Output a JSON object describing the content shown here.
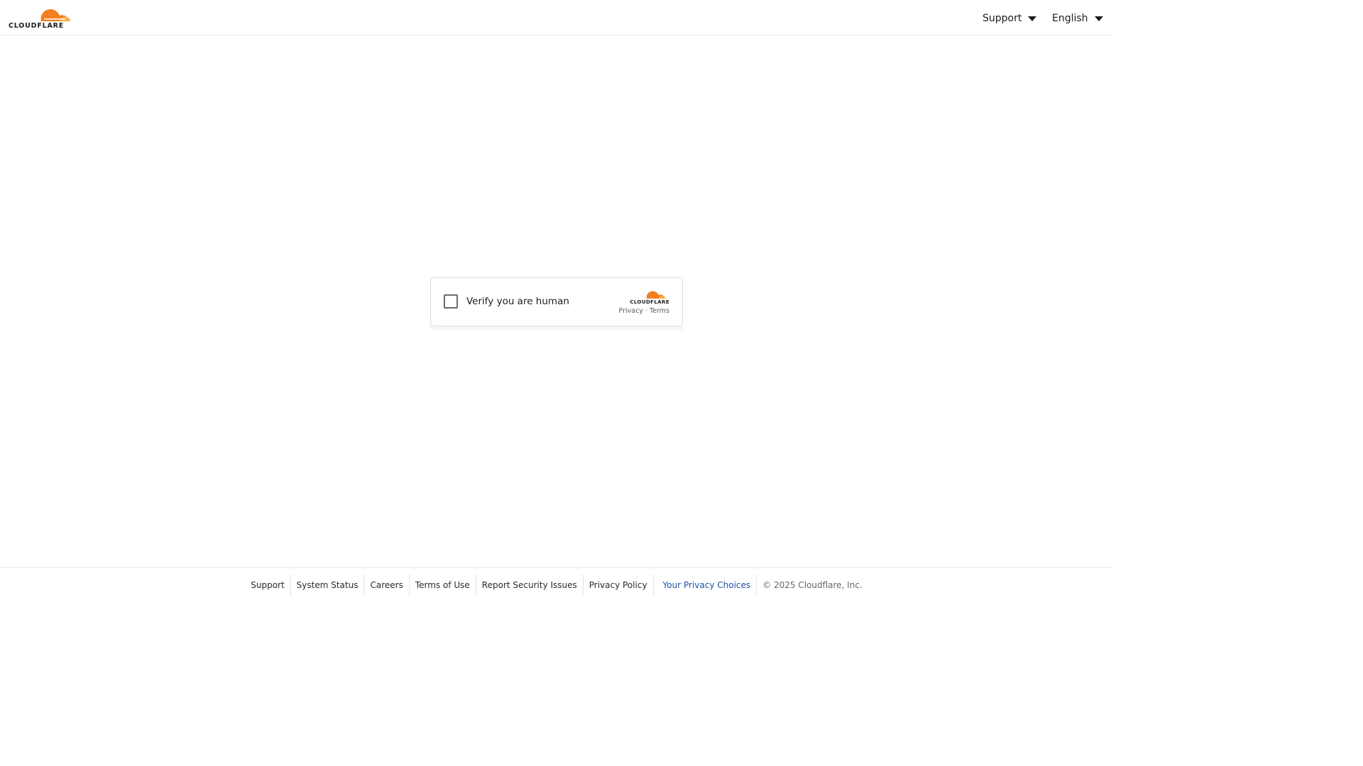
{
  "header": {
    "logo_text": "CLOUDFLARE",
    "nav": {
      "support_label": "Support",
      "language_label": "English"
    }
  },
  "widget": {
    "checkbox_label": "Verify you are human",
    "brand_text": "CLOUDFLARE",
    "privacy_label": "Privacy",
    "separator": "·",
    "terms_label": "Terms"
  },
  "footer": {
    "links": [
      "Support",
      "System Status",
      "Careers",
      "Terms of Use",
      "Report Security Issues",
      "Privacy Policy"
    ],
    "privacy_choices": "Your Privacy Choices",
    "copyright": "© 2025 Cloudflare, Inc."
  },
  "colors": {
    "brand_orange": "#f38020",
    "brand_light_orange": "#faae40",
    "link_blue": "#1f4fa8"
  }
}
